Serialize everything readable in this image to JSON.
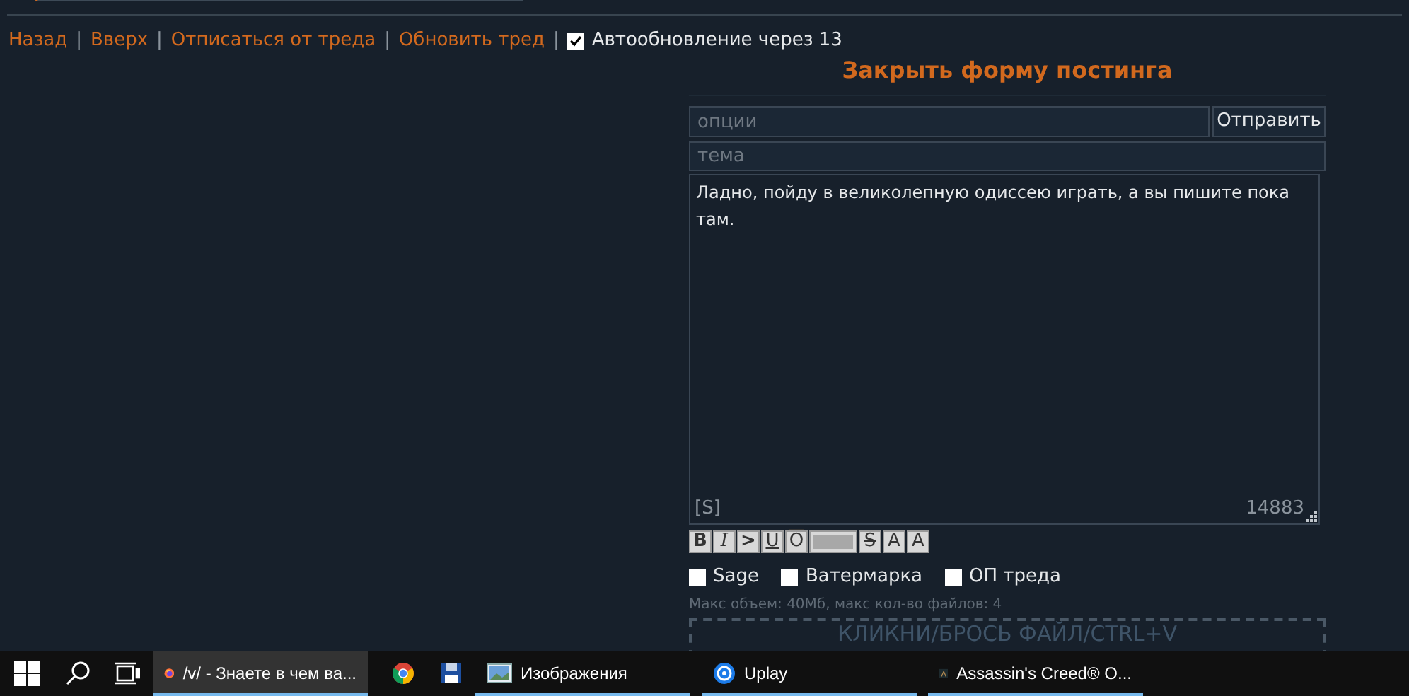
{
  "nav_links": [
    {
      "label": "Назад"
    },
    {
      "label": "Вверх"
    },
    {
      "label": "Отписаться от треда"
    },
    {
      "label": "Обновить тред"
    }
  ],
  "separator": "|",
  "autoupdate": {
    "label": "Автообновление через 13",
    "checked": true
  },
  "form": {
    "close_link": "Закрыть форму постинга",
    "options": {
      "placeholder": "опции"
    },
    "submit": "Отправить",
    "subject": {
      "placeholder": "тема"
    },
    "message": {
      "value": "Ладно, пойду в великолепную одиссею играть, а вы пишите пока там.",
      "sage_tag": "[S]",
      "counter": "14883"
    },
    "format_buttons": [
      {
        "kind": "text",
        "label": "B"
      },
      {
        "kind": "text",
        "label": "I"
      },
      {
        "kind": "text",
        "label": ">"
      },
      {
        "kind": "text",
        "label": "U"
      },
      {
        "kind": "text",
        "label": "O"
      },
      {
        "kind": "spoiler"
      },
      {
        "kind": "text",
        "label": "S"
      },
      {
        "kind": "text",
        "label": "A"
      },
      {
        "kind": "text",
        "label": "A"
      }
    ],
    "checkboxes": [
      {
        "label": "Sage",
        "checked": false
      },
      {
        "label": "Ватермарка",
        "checked": false
      },
      {
        "label": "ОП треда",
        "checked": false
      }
    ],
    "limits": "Макс объем: 40Мб, макс кол-во файлов: 4",
    "dropzone": "КЛИКНИ/БРОСЬ ФАЙЛ/CTRL+V"
  },
  "taskbar": {
    "items": [
      {
        "kind": "window",
        "label": "/v/ - Знаете в чем ва...",
        "selected": true,
        "running": true
      },
      {
        "kind": "pinned",
        "running": false
      },
      {
        "kind": "pinned",
        "running": false
      },
      {
        "kind": "window",
        "label": "Изображения",
        "selected": false,
        "running": true
      },
      {
        "kind": "window",
        "label": "Uplay",
        "selected": false,
        "running": true
      },
      {
        "kind": "window",
        "label": "Assassin's Creed® O...",
        "selected": false,
        "running": true
      }
    ]
  }
}
